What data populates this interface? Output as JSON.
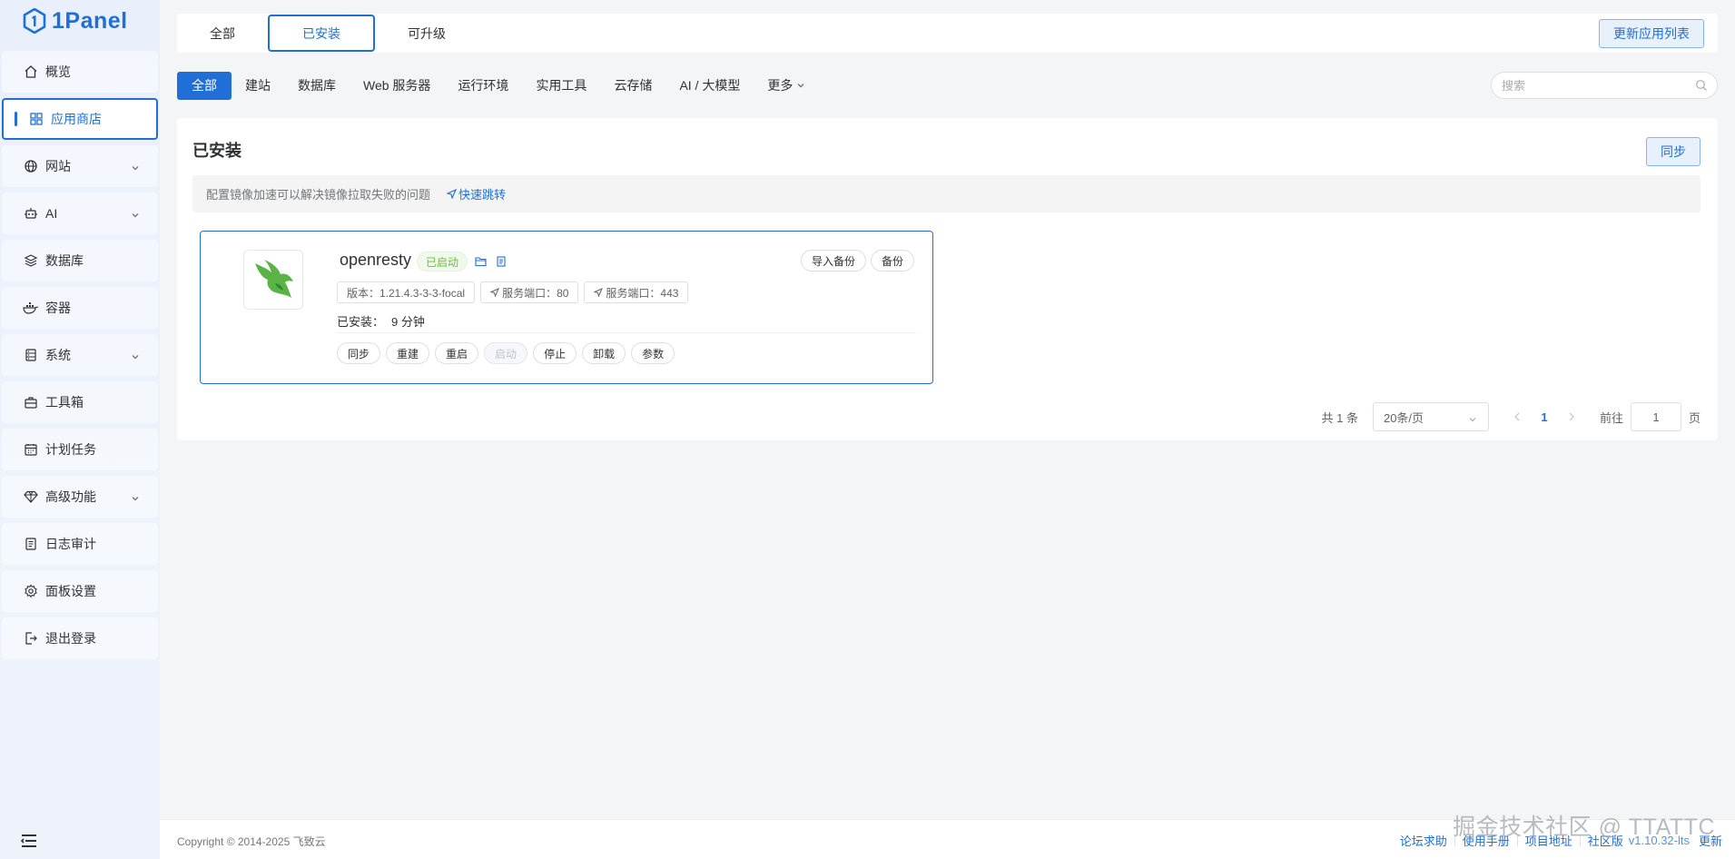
{
  "brand": {
    "name": "1Panel",
    "color": "#1f6fd6"
  },
  "sidebar": {
    "items": [
      {
        "label": "概览",
        "icon": "home-icon"
      },
      {
        "label": "应用商店",
        "icon": "grid-icon",
        "active": true
      },
      {
        "label": "网站",
        "icon": "globe-icon",
        "expandable": true
      },
      {
        "label": "AI",
        "icon": "robot-icon",
        "expandable": true
      },
      {
        "label": "数据库",
        "icon": "layers-icon"
      },
      {
        "label": "容器",
        "icon": "docker-icon"
      },
      {
        "label": "系统",
        "icon": "server-icon",
        "expandable": true
      },
      {
        "label": "工具箱",
        "icon": "toolbox-icon"
      },
      {
        "label": "计划任务",
        "icon": "calendar-icon"
      },
      {
        "label": "高级功能",
        "icon": "diamond-icon",
        "expandable": true
      },
      {
        "label": "日志审计",
        "icon": "log-icon"
      },
      {
        "label": "面板设置",
        "icon": "gear-icon"
      },
      {
        "label": "退出登录",
        "icon": "logout-icon"
      }
    ]
  },
  "topbar": {
    "tabs": [
      {
        "label": "全部"
      },
      {
        "label": "已安装",
        "active": true
      },
      {
        "label": "可升级"
      }
    ],
    "update_button": "更新应用列表"
  },
  "filters": {
    "chips": [
      "全部",
      "建站",
      "数据库",
      "Web 服务器",
      "运行环境",
      "实用工具",
      "云存储",
      "AI / 大模型",
      "更多"
    ],
    "active": "全部",
    "search_placeholder": "搜索"
  },
  "panel": {
    "title": "已安装",
    "sync_button": "同步",
    "notice": "配置镜像加速可以解决镜像拉取失败的问题",
    "notice_link": "快速跳转"
  },
  "app": {
    "name": "openresty",
    "status": "已启动",
    "top_actions": [
      "导入备份",
      "备份"
    ],
    "version": "版本：1.21.4.3-3-3-focal",
    "port1": "服务端口：80",
    "port2": "服务端口：443",
    "installed_label": "已安装：",
    "installed_value": "9 分钟",
    "actions": [
      "同步",
      "重建",
      "重启",
      "启动",
      "停止",
      "卸载",
      "参数"
    ],
    "disabled_action": "启动"
  },
  "pagination": {
    "total": "共 1 条",
    "page_size": "20条/页",
    "current_page": "1",
    "goto_label": "前往",
    "goto_value": "1",
    "page_suffix": "页"
  },
  "footer": {
    "copyright": "Copyright © 2014-2025 飞致云",
    "links": [
      "论坛求助",
      "使用手册",
      "项目地址",
      "社区版"
    ],
    "version": "v1.10.32-lts",
    "update": "更新",
    "watermark": "掘金技术社区 @ TTATTC"
  }
}
